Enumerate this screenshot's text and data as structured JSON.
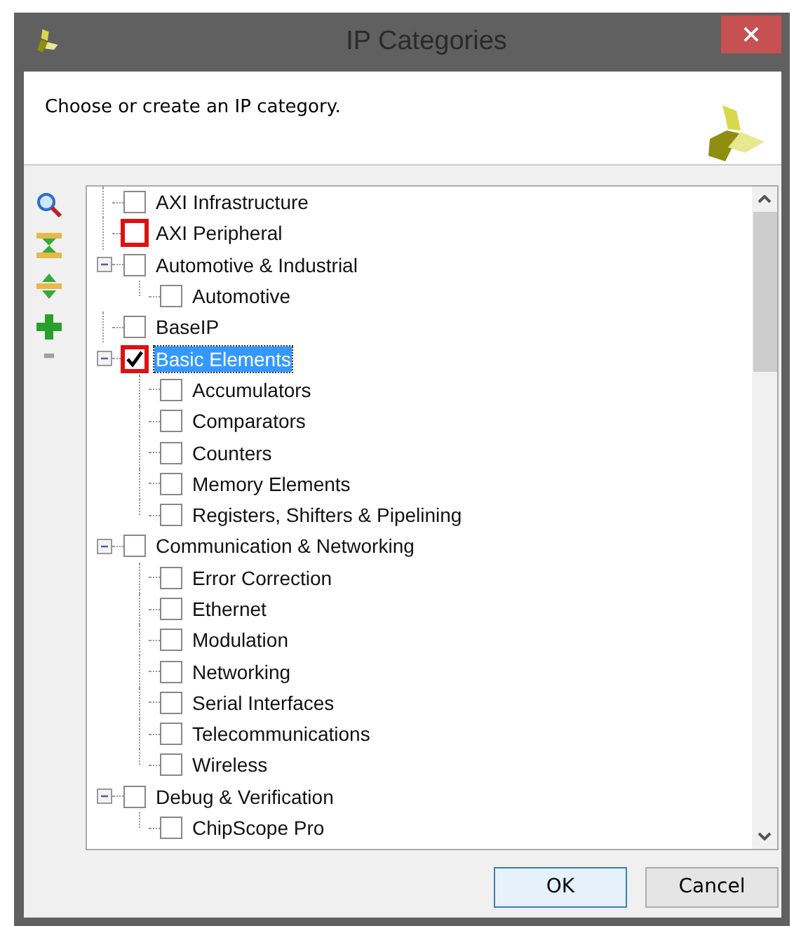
{
  "window": {
    "title": "IP Categories"
  },
  "header": {
    "message": "Choose or create an IP category."
  },
  "toolbar": [
    {
      "kind": "search",
      "disabled": false
    },
    {
      "kind": "collapse",
      "disabled": false
    },
    {
      "kind": "expand",
      "disabled": false
    },
    {
      "kind": "add",
      "disabled": false
    },
    {
      "kind": "remove",
      "disabled": true
    }
  ],
  "tree": [
    {
      "label": "AXI Infrastructure",
      "checked": false,
      "flagged": false,
      "selected": false
    },
    {
      "label": "AXI Peripheral",
      "checked": false,
      "flagged": true,
      "selected": false
    },
    {
      "label": "Automotive & Industrial",
      "checked": false,
      "flagged": false,
      "selected": false,
      "expanded": true,
      "children": [
        {
          "label": "Automotive",
          "checked": false,
          "flagged": false,
          "selected": false
        }
      ]
    },
    {
      "label": "BaseIP",
      "checked": false,
      "flagged": false,
      "selected": false
    },
    {
      "label": "Basic Elements",
      "checked": true,
      "flagged": true,
      "selected": true,
      "expanded": true,
      "children": [
        {
          "label": "Accumulators",
          "checked": false,
          "flagged": false,
          "selected": false
        },
        {
          "label": "Comparators",
          "checked": false,
          "flagged": false,
          "selected": false
        },
        {
          "label": "Counters",
          "checked": false,
          "flagged": false,
          "selected": false
        },
        {
          "label": "Memory Elements",
          "checked": false,
          "flagged": false,
          "selected": false
        },
        {
          "label": "Registers, Shifters & Pipelining",
          "checked": false,
          "flagged": false,
          "selected": false
        }
      ]
    },
    {
      "label": "Communication & Networking",
      "checked": false,
      "flagged": false,
      "selected": false,
      "expanded": true,
      "children": [
        {
          "label": "Error Correction",
          "checked": false,
          "flagged": false,
          "selected": false
        },
        {
          "label": "Ethernet",
          "checked": false,
          "flagged": false,
          "selected": false
        },
        {
          "label": "Modulation",
          "checked": false,
          "flagged": false,
          "selected": false
        },
        {
          "label": "Networking",
          "checked": false,
          "flagged": false,
          "selected": false
        },
        {
          "label": "Serial Interfaces",
          "checked": false,
          "flagged": false,
          "selected": false
        },
        {
          "label": "Telecommunications",
          "checked": false,
          "flagged": false,
          "selected": false
        },
        {
          "label": "Wireless",
          "checked": false,
          "flagged": false,
          "selected": false
        }
      ]
    },
    {
      "label": "Debug & Verification",
      "checked": false,
      "flagged": false,
      "selected": false,
      "expanded": true,
      "children": [
        {
          "label": "ChipScope Pro",
          "checked": false,
          "flagged": false,
          "selected": false
        }
      ]
    }
  ],
  "buttons": [
    {
      "label": "OK",
      "default": true
    },
    {
      "label": "Cancel",
      "default": false
    }
  ]
}
